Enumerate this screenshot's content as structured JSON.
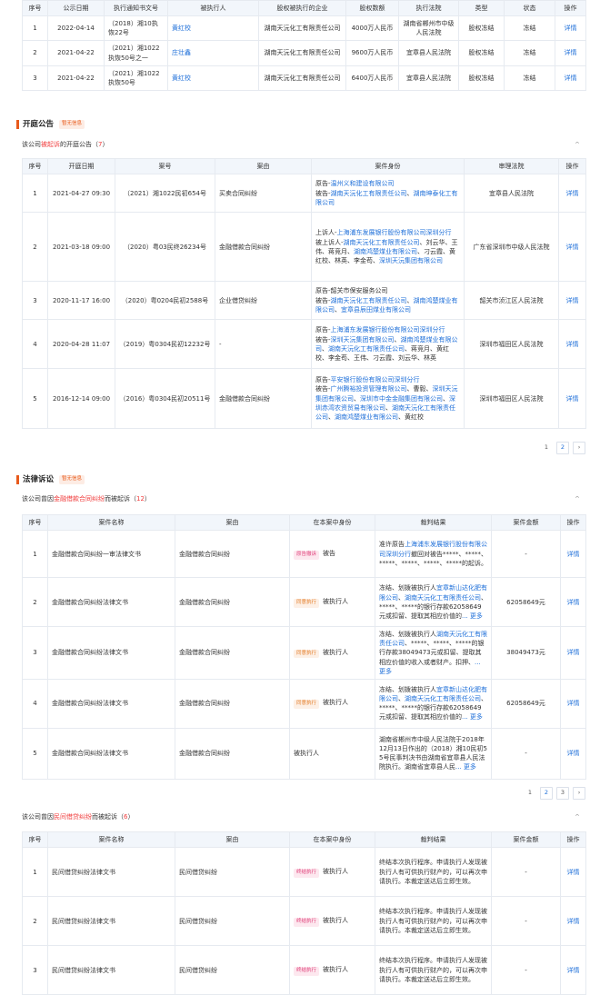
{
  "equity": {
    "headers": [
      "序号",
      "公示日期",
      "执行通知书文号",
      "被执行人",
      "股权被执行的企业",
      "股权数额",
      "执行法院",
      "类型",
      "状态",
      "操作"
    ],
    "rows": [
      [
        "1",
        "2022-04-14",
        "（2018）湘10执恢22号",
        "黄红校",
        "湖南天沅化工有限责任公司",
        "4000万人民币",
        "湖南省郴州市中级人民法院",
        "股权冻结",
        "冻结",
        "详情"
      ],
      [
        "2",
        "2021-04-22",
        "（2021）湘1022执恢50号之一",
        "庄壮鑫",
        "湖南天沅化工有限责任公司",
        "9600万人民币",
        "宜章县人民法院",
        "股权冻结",
        "冻结",
        "详情"
      ],
      [
        "3",
        "2021-04-22",
        "（2021）湘1022执恢50号",
        "黄红校",
        "湖南天沅化工有限责任公司",
        "6400万人民币",
        "宜章县人民法院",
        "股权冻结",
        "冻结",
        "详情"
      ]
    ]
  },
  "hearing": {
    "title": "开庭公告",
    "tag": "暂无信息",
    "sub_pre": "该公司",
    "sub_hl": "被起诉",
    "sub_post": "的开庭公告（",
    "count": "7",
    "sub_end": "）",
    "headers": [
      "序号",
      "开庭日期",
      "案号",
      "案由",
      "案件身份",
      "审理法院",
      "操作"
    ],
    "rows": [
      {
        "no": "1",
        "date": "2021-04-27 09:30",
        "case": "（2021）湘1022民初654号",
        "reason": "买卖合同纠纷",
        "court": "宜章县人民法院",
        "op": "详情",
        "lines": [
          [
            {
              "t": "原告-"
            },
            {
              "t": "温州义和建设有限公司",
              "b": 1
            }
          ],
          [
            {
              "t": "被告-"
            },
            {
              "t": "湖南天沅化工有限责任公司",
              "b": 1
            },
            {
              "t": "、"
            },
            {
              "t": "湖南坤泰化工有限公司",
              "b": 1
            }
          ]
        ]
      },
      {
        "no": "2",
        "date": "2021-03-18 09:00",
        "case": "（2020）粤03民终26234号",
        "reason": "金融借款合同纠纷",
        "court": "广东省深圳市中级人民法院",
        "op": "详情",
        "lines": [
          [
            {
              "t": "上诉人-"
            },
            {
              "t": "上海浦东发展银行股份有限公司深圳分行",
              "b": 1
            }
          ],
          [
            {
              "t": "被上诉人-"
            },
            {
              "t": "湖南天沅化工有限责任公司",
              "b": 1
            },
            {
              "t": "、刘云华、王伟、蒋竞月、"
            },
            {
              "t": "湖南鸿楚煤业有限公司",
              "b": 1
            },
            {
              "t": "、刁云霞、黄红校、林英、李金苟、"
            },
            {
              "t": "深圳天沅集团有限公司",
              "b": 1
            }
          ]
        ]
      },
      {
        "no": "3",
        "date": "2020-11-17 16:00",
        "case": "（2020）粤0204民初2588号",
        "reason": "企业借贷纠纷",
        "court": "韶关市浈江区人民法院",
        "op": "详情",
        "lines": [
          [
            {
              "t": "原告-韶关市保安服务公司"
            }
          ],
          [
            {
              "t": "被告-"
            },
            {
              "t": "湖南天沅化工有限责任公司",
              "b": 1
            },
            {
              "t": "、"
            },
            {
              "t": "湖南鸿楚煤业有限公司",
              "b": 1
            },
            {
              "t": "、"
            },
            {
              "t": "宜章县辰田煤业有限公司",
              "b": 1
            }
          ]
        ]
      },
      {
        "no": "4",
        "date": "2020-04-28 11:07",
        "case": "（2019）粤0304民初12232号",
        "reason": "-",
        "court": "深圳市福田区人民法院",
        "op": "详情",
        "lines": [
          [
            {
              "t": "原告-"
            },
            {
              "t": "上海浦东发展银行股份有限公司深圳分行",
              "b": 1
            }
          ],
          [
            {
              "t": "被告-"
            },
            {
              "t": "深圳天沅集团有限公司",
              "b": 1
            },
            {
              "t": "、"
            },
            {
              "t": "湖南鸿楚煤业有限公司",
              "b": 1
            },
            {
              "t": "、"
            },
            {
              "t": "湖南天沅化工有限责任公司",
              "b": 1
            },
            {
              "t": "、蒋竞月、黄红校、李金苟、王伟、刁云霞、刘云华、林英"
            }
          ]
        ]
      },
      {
        "no": "5",
        "date": "2016-12-14 09:00",
        "case": "（2016）粤0304民初20511号",
        "reason": "金融借款合同纠纷",
        "court": "深圳市福田区人民法院",
        "op": "详情",
        "lines": [
          [
            {
              "t": "原告-"
            },
            {
              "t": "平安银行股份有限公司深圳分行",
              "b": 1
            }
          ],
          [
            {
              "t": "被告-"
            },
            {
              "t": "广州腾裕投资管理有限公司",
              "b": 1
            },
            {
              "t": "、曹毅、"
            },
            {
              "t": "深圳天沅集团有限公司",
              "b": 1
            },
            {
              "t": "、"
            },
            {
              "t": "深圳市中金金融集团有限公司",
              "b": 1
            },
            {
              "t": "、"
            },
            {
              "t": "深圳赤湾农资贸易有限公司",
              "b": 1
            },
            {
              "t": "、"
            },
            {
              "t": "湖南天沅化工有限责任公司",
              "b": 1
            },
            {
              "t": "、"
            },
            {
              "t": "湖南鸿楚煤业有限公司",
              "b": 1
            },
            {
              "t": "、黄红校"
            }
          ]
        ]
      }
    ],
    "pages": [
      "1",
      "2"
    ]
  },
  "lawsuit": {
    "title": "法律诉讼",
    "tag": "暂无信息",
    "sub_pre": "该公司曾因",
    "sub_hl": "金融借款合同纠纷",
    "sub_post": "而被起诉（",
    "count": "12",
    "sub_end": "）",
    "headers": [
      "序号",
      "案件名称",
      "案由",
      "在本案中身份",
      "裁判结果",
      "案件金额",
      "操作"
    ],
    "rows": [
      {
        "no": "1",
        "name": "金融借款合同纠纷一审法律文书",
        "reason": "金融借款合同纠纷",
        "role_tag": "原告撤诉",
        "role_cls": "pink",
        "role": "被告",
        "amount": "-",
        "op": "详情",
        "result": [
          {
            "t": "准许原告"
          },
          {
            "t": "上海浦东发展银行股份有限公司深圳分行",
            "b": 1
          },
          {
            "t": "撤回对被告*****、*****、*****、*****、*****、*****的起诉。"
          }
        ]
      },
      {
        "no": "2",
        "name": "金融借款合同纠纷法律文书",
        "reason": "金融借款合同纠纷",
        "role_tag": "同意执行",
        "role_cls": "orange",
        "role": "被执行人",
        "amount": "62058649元",
        "op": "详情",
        "result": [
          {
            "t": "冻结、划拨被执行人"
          },
          {
            "t": "宜章新山达化肥有限公司",
            "b": 1
          },
          {
            "t": "、"
          },
          {
            "t": "湖南天沅化工有限责任公司",
            "b": 1
          },
          {
            "t": "、*****、*****的银行存款62058649元或扣留、提取其相应价值的"
          },
          {
            "t": "... 更多",
            "b": 1
          }
        ]
      },
      {
        "no": "3",
        "name": "金融借款合同纠纷法律文书",
        "reason": "金融借款合同纠纷",
        "role_tag": "同意执行",
        "role_cls": "orange",
        "role": "被执行人",
        "amount": "38049473元",
        "op": "详情",
        "result": [
          {
            "t": "冻结、划拨被执行人"
          },
          {
            "t": "湖南天沅化工有限责任公司",
            "b": 1
          },
          {
            "t": "、*****、*****、*****的银行存款38049473元或扣留、提取其相应价值的收入或者财产。扣押、"
          },
          {
            "t": "... 更多",
            "b": 1
          }
        ]
      },
      {
        "no": "4",
        "name": "金融借款合同纠纷法律文书",
        "reason": "金融借款合同纠纷",
        "role_tag": "同意执行",
        "role_cls": "orange",
        "role": "被执行人",
        "amount": "62058649元",
        "op": "详情",
        "result": [
          {
            "t": "冻结、划拨被执行人"
          },
          {
            "t": "宜章新山达化肥有限公司",
            "b": 1
          },
          {
            "t": "、"
          },
          {
            "t": "湖南天沅化工有限责任公司",
            "b": 1
          },
          {
            "t": "、*****、*****的银行存款62058649元或扣留、提取其相应价值的"
          },
          {
            "t": "... 更多",
            "b": 1
          }
        ]
      },
      {
        "no": "5",
        "name": "金融借款合同纠纷法律文书",
        "reason": "金融借款合同纠纷",
        "role_tag": "",
        "role_cls": "",
        "role": "被执行人",
        "amount": "-",
        "op": "详情",
        "result": [
          {
            "t": "湖南省郴州市中级人民法院于2018年12月13日作出的（2018）湘10民初55号民事判决书由湖南省宜章县人民法院执行。湖南省宜章县人民"
          },
          {
            "t": "... 更多",
            "b": 1
          }
        ]
      }
    ],
    "pages": [
      "1",
      "2",
      "3"
    ]
  },
  "loan": {
    "sub_pre": "该公司曾因",
    "sub_hl": "民间借贷纠纷",
    "sub_post": "而被起诉（",
    "count": "6",
    "sub_end": "）",
    "headers": [
      "序号",
      "案件名称",
      "案由",
      "在本案中身份",
      "裁判结果",
      "案件金额",
      "操作"
    ],
    "rows": [
      {
        "no": "1",
        "name": "民间借贷纠纷法律文书",
        "reason": "民间借贷纠纷",
        "role_tag": "终结执行",
        "role_cls": "pink",
        "role": "被执行人",
        "amount": "-",
        "op": "详情",
        "result": [
          {
            "t": "终结本次执行程序。申请执行人发现被执行人有可供执行财产的，可以再次申请执行。本裁定送达后立即生效。"
          }
        ]
      },
      {
        "no": "2",
        "name": "民间借贷纠纷法律文书",
        "reason": "民间借贷纠纷",
        "role_tag": "终结执行",
        "role_cls": "pink",
        "role": "被执行人",
        "amount": "-",
        "op": "详情",
        "result": [
          {
            "t": "终结本次执行程序。申请执行人发现被执行人有可供执行财产的，可以再次申请执行。本裁定送达后立即生效。"
          }
        ]
      },
      {
        "no": "3",
        "name": "民间借贷纠纷法律文书",
        "reason": "民间借贷纠纷",
        "role_tag": "终结执行",
        "role_cls": "pink",
        "role": "被执行人",
        "amount": "-",
        "op": "详情",
        "result": [
          {
            "t": "终结本次执行程序。申请执行人发现被执行人有可供执行财产的，可以再次申请执行。本裁定送达后立即生效。"
          }
        ]
      }
    ]
  }
}
